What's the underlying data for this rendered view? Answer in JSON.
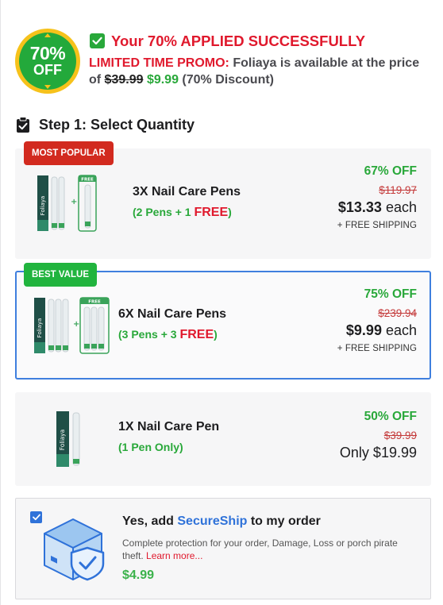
{
  "promo": {
    "badge_percent": "70%",
    "badge_off": "OFF",
    "applied_text": "Your 70% APPLIED SUCCESSFULLY",
    "limited_label": "LIMITED TIME PROMO:",
    "line_a": " Foliaya is available at the price of ",
    "old_price": "$39.99",
    "new_price": "$9.99",
    "discount_text": " (70% Discount)"
  },
  "step": {
    "title": "Step 1: Select Quantity"
  },
  "offers": [
    {
      "ribbon": "MOST POPULAR",
      "name": "3X Nail Care Pens",
      "sub_prefix": "(2 Pens + 1 ",
      "sub_free": "FREE",
      "sub_suffix": ")",
      "percent_off": "67% OFF",
      "old_price": "$119.97",
      "price": "$13.33",
      "price_suffix": " each",
      "shipping": "+ FREE SHIPPING",
      "product_brand": "Foliaya",
      "free_tag": "FREE"
    },
    {
      "ribbon": "BEST VALUE",
      "name": "6X Nail Care Pens",
      "sub_prefix": "(3 Pens + 3 ",
      "sub_free": "FREE",
      "sub_suffix": ")",
      "percent_off": "75% OFF",
      "old_price": "$239.94",
      "price": "$9.99",
      "price_suffix": " each",
      "shipping": "+ FREE SHIPPING",
      "product_brand": "Foliaya",
      "free_tag": "FREE"
    },
    {
      "name": "1X Nail Care Pen",
      "sub": "(1 Pen Only)",
      "percent_off": "50% OFF",
      "old_price": "$39.99",
      "price_line": "Only $19.99",
      "product_brand": "Foliaya"
    }
  ],
  "secureship": {
    "title_prefix": "Yes, add ",
    "title_brand": "SecureShip",
    "title_suffix": " to my order",
    "description": "Complete protection for your order, Damage, Loss or porch pirate theft. ",
    "learn_more": "Learn more...",
    "price": "$4.99"
  },
  "colors": {
    "accent_red": "#e0192d",
    "accent_green": "#29a83a",
    "selected_border": "#3f7fde",
    "badge_gold": "#f6c21b"
  }
}
